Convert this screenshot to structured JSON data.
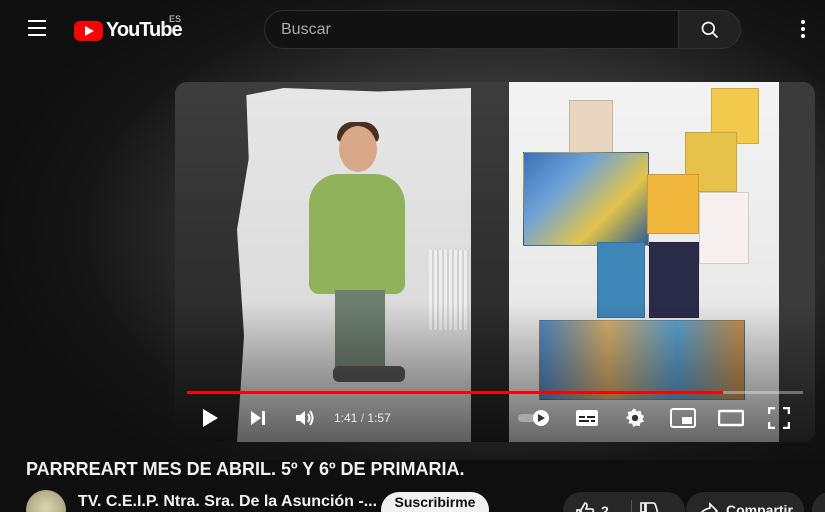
{
  "header": {
    "logo_text": "YouTube",
    "region_code": "ES",
    "search_placeholder": "Buscar"
  },
  "player": {
    "time_current": "1:41",
    "time_separator": "/",
    "time_total": "1:57",
    "progress_fraction": 0.87
  },
  "video": {
    "title": "PARRREART MES DE ABRIL. 5º Y 6º DE PRIMARIA."
  },
  "channel": {
    "name": "TV. C.E.I.P. Ntra. Sra. De la Asunción -...",
    "subscribe_label": "Suscribirme"
  },
  "actions": {
    "like_count": "2",
    "share_label": "Compartir"
  },
  "colors": {
    "brand_red": "#ff0000",
    "background": "#0f0f0f"
  }
}
